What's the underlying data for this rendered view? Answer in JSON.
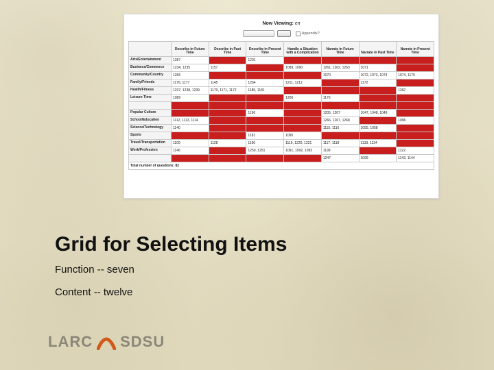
{
  "header": {
    "now_viewing_label": "Now Viewing:",
    "now_viewing_value": "en",
    "checkbox_label": "Appendix?"
  },
  "grid": {
    "row_header_blank": "",
    "columns": [
      "Describe in Future Time",
      "Describe in Past Time",
      "Describe in Present Time",
      "Handle a Situation with a Complication",
      "Narrate in Future Time",
      "Narrate in Past Time",
      "Narrate in Present Time"
    ],
    "rows": [
      {
        "label": "Arts/Entertainment",
        "cells": [
          {
            "v": "1287",
            "r": false
          },
          {
            "v": "",
            "r": true
          },
          {
            "v": "1201",
            "r": false
          },
          {
            "v": "",
            "r": true
          },
          {
            "v": "",
            "r": true
          },
          {
            "v": "",
            "r": true
          },
          {
            "v": "",
            "r": true
          }
        ]
      },
      {
        "label": "Business/Commerce",
        "cells": [
          {
            "v": "1234, 1235",
            "r": false
          },
          {
            "v": "1157",
            "r": false
          },
          {
            "v": "",
            "r": true
          },
          {
            "v": "1089, 1090",
            "r": false
          },
          {
            "v": "1261, 1262, 1263",
            "r": false
          },
          {
            "v": "1071",
            "r": false
          },
          {
            "v": "",
            "r": true
          }
        ]
      },
      {
        "label": "Community/Country",
        "cells": [
          {
            "v": "1256",
            "r": false
          },
          {
            "v": "",
            "r": true
          },
          {
            "v": "",
            "r": true
          },
          {
            "v": "",
            "r": true
          },
          {
            "v": "1070",
            "r": false
          },
          {
            "v": "1072, 1073, 1074",
            "r": false
          },
          {
            "v": "1074, 1175",
            "r": false
          }
        ]
      },
      {
        "label": "Family/Friends",
        "cells": [
          {
            "v": "1176, 1177",
            "r": false
          },
          {
            "v": "1145",
            "r": false
          },
          {
            "v": "1264",
            "r": false
          },
          {
            "v": "1211, 1212",
            "r": false
          },
          {
            "v": "",
            "r": true
          },
          {
            "v": "1172",
            "r": false
          },
          {
            "v": "",
            "r": true
          }
        ]
      },
      {
        "label": "Health/Fitness",
        "cells": [
          {
            "v": "1237, 1238, 1239",
            "r": false
          },
          {
            "v": "1170, 1171, 1172",
            "r": false
          },
          {
            "v": "1180, 1181",
            "r": false
          },
          {
            "v": "",
            "r": true
          },
          {
            "v": "",
            "r": true
          },
          {
            "v": "",
            "r": true
          },
          {
            "v": "1182",
            "r": false
          }
        ]
      },
      {
        "label": "Leisure Time",
        "cells": [
          {
            "v": "1089",
            "r": false
          },
          {
            "v": "",
            "r": true
          },
          {
            "v": "",
            "r": true
          },
          {
            "v": "1206",
            "r": false
          },
          {
            "v": "1170",
            "r": false
          },
          {
            "v": "",
            "r": true
          },
          {
            "v": "",
            "r": true
          }
        ]
      },
      {
        "label": "",
        "cells": [
          {
            "v": "",
            "r": true
          },
          {
            "v": "",
            "r": true
          },
          {
            "v": "",
            "r": true
          },
          {
            "v": "",
            "r": true
          },
          {
            "v": "",
            "r": true
          },
          {
            "v": "",
            "r": true
          },
          {
            "v": "",
            "r": true
          }
        ]
      },
      {
        "label": "Popular Culture",
        "cells": [
          {
            "v": "",
            "r": true
          },
          {
            "v": "",
            "r": true
          },
          {
            "v": "1196",
            "r": false
          },
          {
            "v": "",
            "r": true
          },
          {
            "v": "1205, 1207",
            "r": false
          },
          {
            "v": "1047, 1048, 1049",
            "r": false
          },
          {
            "v": "",
            "r": true
          }
        ]
      },
      {
        "label": "School/Education",
        "cells": [
          {
            "v": "1112, 1113, 1114",
            "r": false
          },
          {
            "v": "",
            "r": true
          },
          {
            "v": "",
            "r": true
          },
          {
            "v": "",
            "r": true
          },
          {
            "v": "1266, 1267, 1268",
            "r": false
          },
          {
            "v": "",
            "r": true
          },
          {
            "v": "1096",
            "r": false
          }
        ]
      },
      {
        "label": "Science/Technology",
        "cells": [
          {
            "v": "1140",
            "r": false
          },
          {
            "v": "",
            "r": true
          },
          {
            "v": "",
            "r": true
          },
          {
            "v": "",
            "r": true
          },
          {
            "v": "1115, 1116",
            "r": false
          },
          {
            "v": "1055, 1058",
            "r": false
          },
          {
            "v": "",
            "r": true
          }
        ]
      },
      {
        "label": "Sports",
        "cells": [
          {
            "v": "",
            "r": true
          },
          {
            "v": "",
            "r": true
          },
          {
            "v": "1181",
            "r": false
          },
          {
            "v": "1095",
            "r": false
          },
          {
            "v": "",
            "r": true
          },
          {
            "v": "",
            "r": true
          },
          {
            "v": "",
            "r": true
          }
        ]
      },
      {
        "label": "Travel/Transportation",
        "cells": [
          {
            "v": "1109",
            "r": false
          },
          {
            "v": "1128",
            "r": false
          },
          {
            "v": "1190",
            "r": false
          },
          {
            "v": "1119, 1220, 1221",
            "r": false
          },
          {
            "v": "1117, 1118",
            "r": false
          },
          {
            "v": "1133, 1134",
            "r": false
          },
          {
            "v": "",
            "r": true
          }
        ]
      },
      {
        "label": "Work/Profession",
        "cells": [
          {
            "v": "1146",
            "r": false
          },
          {
            "v": "",
            "r": true
          },
          {
            "v": "1250, 1251",
            "r": false
          },
          {
            "v": "1091, 1092, 1093",
            "r": false
          },
          {
            "v": "1199",
            "r": false
          },
          {
            "v": "",
            "r": true
          },
          {
            "v": "1122",
            "r": false
          }
        ]
      },
      {
        "label": "",
        "cells": [
          {
            "v": "",
            "r": true
          },
          {
            "v": "",
            "r": true
          },
          {
            "v": "",
            "r": true
          },
          {
            "v": "",
            "r": true
          },
          {
            "v": "1247",
            "r": false
          },
          {
            "v": "1099",
            "r": false
          },
          {
            "v": "1143, 1144",
            "r": false
          }
        ]
      }
    ],
    "total_label": "Total number of questions: 82"
  },
  "text": {
    "title": "Grid for Selecting Items",
    "line1": "Function -- seven",
    "line2": "Content -- twelve"
  },
  "logo": {
    "larc": "LARC",
    "sdsu": "SDSU"
  }
}
